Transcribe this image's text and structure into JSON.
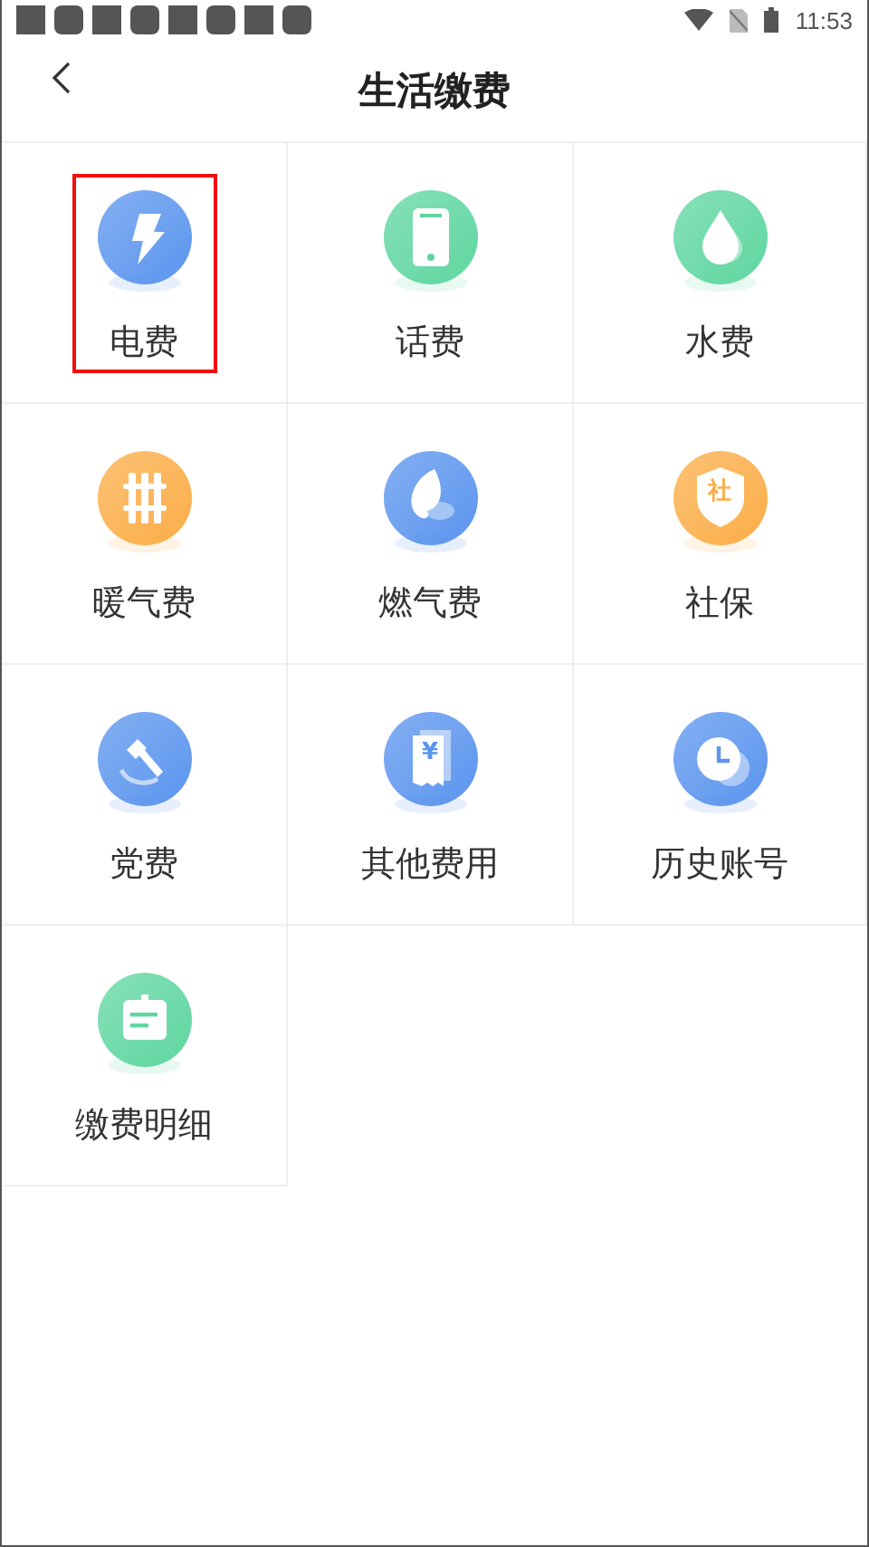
{
  "status_bar": {
    "time": "11:53"
  },
  "header": {
    "title": "生活缴费"
  },
  "items": [
    {
      "label": "电费",
      "kind": "bolt",
      "color": "#5b95ee",
      "selected": true
    },
    {
      "label": "话费",
      "kind": "phone",
      "color": "#5fd6a0",
      "selected": false
    },
    {
      "label": "水费",
      "kind": "drop",
      "color": "#5fd6a0",
      "selected": false
    },
    {
      "label": "暖气费",
      "kind": "radiator",
      "color": "#fbad47",
      "selected": false
    },
    {
      "label": "燃气费",
      "kind": "flame",
      "color": "#5b95ee",
      "selected": false
    },
    {
      "label": "社保",
      "kind": "shield",
      "icon_text": "社",
      "color": "#fbad47",
      "selected": false
    },
    {
      "label": "党费",
      "kind": "hammer",
      "color": "#5b95ee",
      "selected": false
    },
    {
      "label": "其他费用",
      "kind": "receipt",
      "icon_text": "¥",
      "color": "#5b95ee",
      "selected": false
    },
    {
      "label": "历史账号",
      "kind": "clock",
      "color": "#5b95ee",
      "selected": false
    },
    {
      "label": "缴费明细",
      "kind": "card",
      "color": "#5fd6a0",
      "selected": false
    }
  ]
}
